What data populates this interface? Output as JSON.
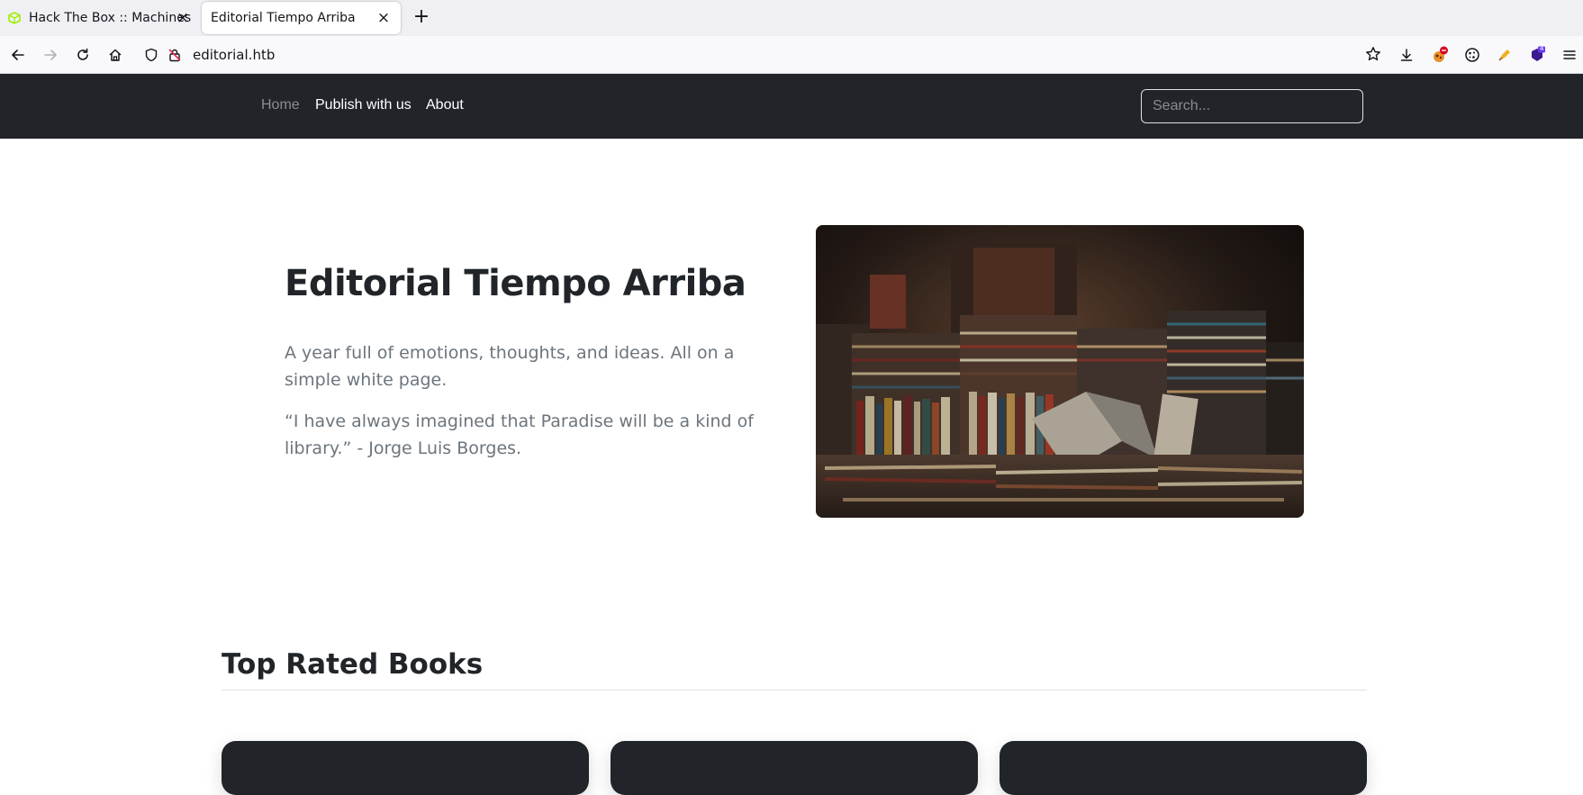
{
  "browser": {
    "tabs": [
      {
        "title": "Hack The Box :: Machines",
        "icon": "hackthebox-cube-icon",
        "active": false
      },
      {
        "title": "Editorial Tiempo Arriba",
        "icon": "none",
        "active": true
      }
    ],
    "url": "editorial.htb",
    "colors": {
      "tabbar": "#f0f0f4",
      "toolbar": "#f9f9fb"
    },
    "toolbar_icons": [
      "back-arrow-icon",
      "forward-arrow-icon",
      "reload-icon",
      "home-icon",
      "bookmark-star-icon",
      "download-icon",
      "extension-icon",
      "cookie-icon",
      "extension-icon",
      "extension-icon",
      "menu-hamburger-icon"
    ],
    "extension_badge": "4"
  },
  "site": {
    "nav": {
      "items": [
        {
          "label": "Home",
          "active": true
        },
        {
          "label": "Publish with us",
          "active": false
        },
        {
          "label": "About",
          "active": false
        }
      ],
      "search_placeholder": "Search..."
    },
    "hero": {
      "title": "Editorial Tiempo Arriba",
      "paragraph_1": "A year full of emotions, thoughts, and ideas. All on a simple white page.",
      "paragraph_2": "“I have always imagined that Paradise will be a kind of library.” - Jorge Luis Borges."
    },
    "section": {
      "title": "Top Rated Books"
    },
    "colors": {
      "navbar": "#212529",
      "text": "#212529",
      "muted": "#6c757d",
      "card": "#212529"
    }
  }
}
